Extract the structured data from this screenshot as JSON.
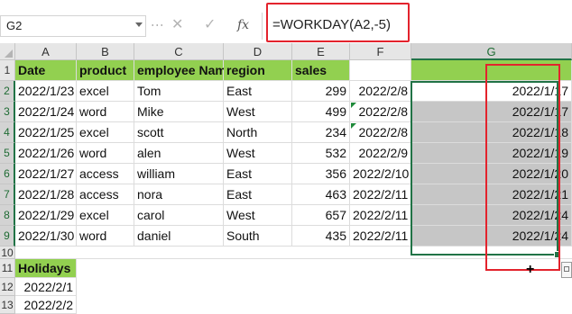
{
  "name_box": {
    "value": "G2"
  },
  "formula_bar": {
    "cancel_icon": "✕",
    "enter_icon": "✓",
    "function_icon": "fx",
    "formula": "=WORKDAY(A2,-5)"
  },
  "columns": [
    "A",
    "B",
    "C",
    "D",
    "E",
    "F",
    "G"
  ],
  "rows": [
    "1",
    "2",
    "3",
    "4",
    "5",
    "6",
    "7",
    "8",
    "9",
    "10",
    "11",
    "12",
    "13"
  ],
  "header_row": [
    "Date",
    "product",
    "employee Nam",
    "region",
    "sales",
    "",
    ""
  ],
  "data_rows": [
    [
      "2022/1/23",
      "excel",
      "Tom",
      "East",
      "299",
      "2022/2/8",
      "2022/1/17"
    ],
    [
      "2022/1/24",
      "word",
      "Mike",
      "West",
      "499",
      "2022/2/8",
      "2022/1/17"
    ],
    [
      "2022/1/25",
      "excel",
      "scott",
      "North",
      "234",
      "2022/2/8",
      "2022/1/18"
    ],
    [
      "2022/1/26",
      "word",
      "alen",
      "West",
      "532",
      "2022/2/9",
      "2022/1/19"
    ],
    [
      "2022/1/27",
      "access",
      "william",
      "East",
      "356",
      "2022/2/10",
      "2022/1/20"
    ],
    [
      "2022/1/28",
      "access",
      "nora",
      "East",
      "463",
      "2022/2/11",
      "2022/1/21"
    ],
    [
      "2022/1/29",
      "excel",
      "carol",
      "West",
      "657",
      "2022/2/11",
      "2022/1/24"
    ],
    [
      "2022/1/30",
      "word",
      "daniel",
      "South",
      "435",
      "2022/2/11",
      "2022/1/24"
    ]
  ],
  "holidays": {
    "label": "Holidays",
    "values": [
      "2022/2/1",
      "2022/2/2"
    ]
  },
  "colors": {
    "header_fill": "#92d050",
    "selection": "#217346",
    "highlight": "#e3232d",
    "selected_fill": "#c6c6c6"
  },
  "cursor": "+"
}
